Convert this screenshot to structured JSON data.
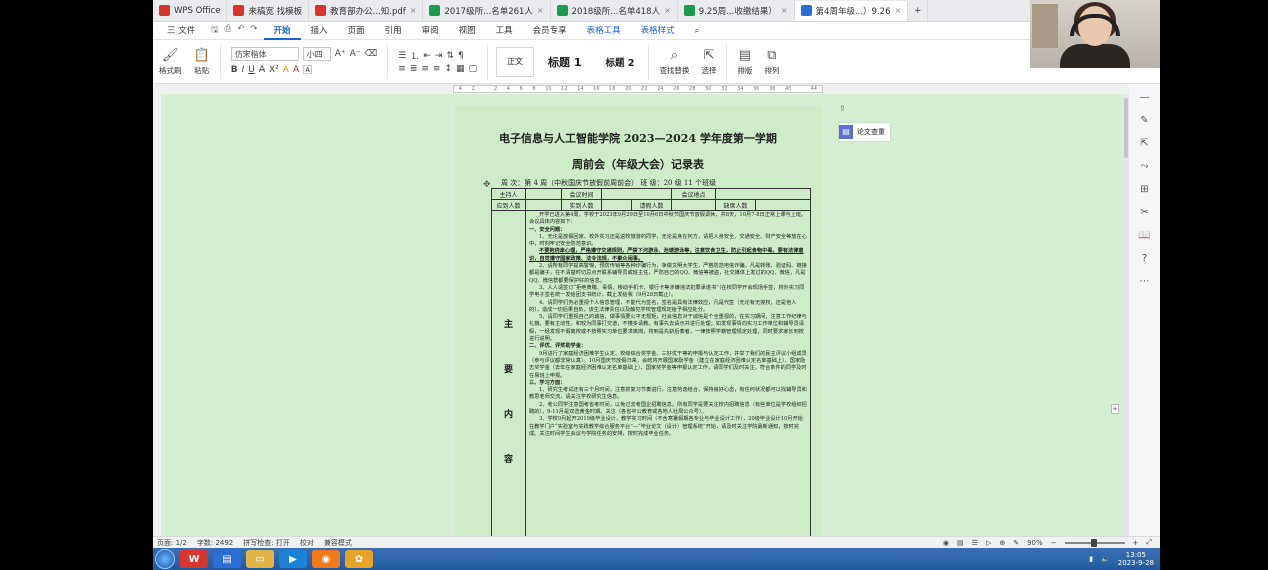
{
  "browser_tabs": [
    {
      "label": "WPS Office",
      "icon": "wps-logo-icon",
      "color": "#d9362b",
      "active": false
    },
    {
      "label": "来稿宽 找模板",
      "icon": "template-icon",
      "color": "#d9362b",
      "active": false
    },
    {
      "label": "教育部办公...知.pdf",
      "icon": "pdf-icon",
      "color": "#d9362b",
      "active": false
    },
    {
      "label": "2017级所...名单261人",
      "icon": "sheet-icon",
      "color": "#1c9a4f",
      "active": false
    },
    {
      "label": "2018级所...名单418人",
      "icon": "sheet-icon",
      "color": "#1c9a4f",
      "active": false
    },
    {
      "label": "9.25周...收缴结果）",
      "icon": "sheet-icon",
      "color": "#1c9a4f",
      "active": false
    },
    {
      "label": "第4周年级...）9.26",
      "icon": "doc-icon",
      "color": "#2b6fd6",
      "active": true
    }
  ],
  "menu": {
    "file": "三 文件",
    "items": [
      "开始",
      "插入",
      "页面",
      "引用",
      "审阅",
      "视图",
      "工具",
      "会员专享"
    ],
    "active": "开始",
    "extra": [
      "表格工具",
      "表格样式"
    ]
  },
  "ribbon": {
    "format_painter": "格式刷",
    "paste": "粘贴",
    "font_name": "仿宋楷体",
    "font_size": "小四",
    "style_normal": "正文",
    "style_h1": "标题 1",
    "style_h2": "标题 2",
    "find_replace": "查找替换",
    "select": "选择",
    "layout": "排版",
    "arrange": "排列"
  },
  "ruler_numbers": [
    "4",
    "2",
    "",
    "2",
    "4",
    "6",
    "8",
    "10",
    "12",
    "14",
    "16",
    "18",
    "20",
    "22",
    "24",
    "26",
    "28",
    "30",
    "32",
    "34",
    "36",
    "38",
    "40",
    "",
    "44"
  ],
  "document": {
    "title": "电子信息与人工智能学院 2023—2024 学年度第一学期",
    "subtitle": "周前会（年级大会）记录表",
    "week_line": "周 次：第 4 周（中秋国庆节放假前周前会）     班 级：20 级 11 个班级",
    "table_row1": [
      "主持人",
      "",
      "会议时间",
      "",
      "会议地点",
      ""
    ],
    "table_row2": [
      "应到人数",
      "",
      "实到人数",
      "",
      "请假人数",
      "",
      "缺席人数",
      ""
    ],
    "section_label": [
      "主",
      "要",
      "内",
      "容"
    ],
    "paragraphs": [
      "开学已进入第4周，学校于2023年9月29日至10月6日中秋节国庆节放假调休，共8天，10月7-8日正常上课与上班。会议具体内容如下：",
      "一、安全问题：",
      "1、无论是放假回家、校外实习还是返校旅游的同学，无论是身在何方，请把人身安全、交通安全、财产安全等放在心中，时刻牢记安全防范意识。",
      "不要抱侥幸心理，严格遵守交通规则，严禁下河游泳、池塘游泳等，注意饮食卫生，防止引起食物中毒。要有法律意识，自觉遵守国家政策、法令法规，不聚众闹事。",
      "2、请所有同学提高警惕，预防传销等各种诈骗行为，争做文明大学生，严格防范电信诈骗。凡是转账、验证码、链接都是骗子，在不清楚时切忌点开联系辅导员或班主任，严防自己的QQ、微信等被盗，社交媒体上发过的QQ、微信，凡是QQ、微信群都要保护好的信息。",
      "3、人人请签订“拒绝黄赌、毒情、移动手机卡、银行卡等涉嫌违法犯罪承诺书”（在校同学开会现场手签，校外实习同学电子签名统一发给团支书统计，截止发给我（9月28日截止）。",
      "4、请同学们务必重视个人信息管理，不能代为签名，签名是具有法律效应，凡是代签（无论有无授权，还是他人的），造成一切后果自负，该生法律责任以及触犯学校管理规定给予相应处分。",
      "5、请同学们重视自己的诚信，做事情要公平无规矩，社会信息对于诚信是个全重视的，在实习期间，注意工作纪律与礼貌，要有主动性，和较为同事打交道，不懂多请教。有事先去请示并进行处理；如发现事情向实习工作单位和辅导员请假，一经发现不假离校或不按照实习单位要求离岗，将到是先斩后奏者，一律按照学籍管理规定处理，同时要求家长到校进行说明。",
      "二、评优、评奖助学金：",
      "9月进行了家庭经济困难学生认定、校级综合奖学金、三好优干等的申报与认定工作，并举了我们的民主评议小组成员（参与评议都非常认真）。10月国庆节放假归来，会统将开展国家励学金（建立在家庭经济困难认定名单基础上）、国家励志奖学金（去年在家庭经济困难认定名单基础上）、国家奖学金等申报认定工作，请同学们及时关注，符合条件的同学及时在易班上申报。",
      "三、学习方面：",
      "1、研究生考试还有三个月时间，注意抓复习节奏进行，注意劳逸结合，保持良好心态，有任何状况都可以找辅导员和教思老师交流，请关注学校研究生信息。",
      "2、考公同学注意国考省考时间，以免过去考国企招聘信息。所有同学是要关注校内招聘信息（有些单位是学校组织招聘的），9-11月是双选黄金时期。关注（各省中公教育或各地人社局公众号）。",
      "3、学校9月起开2019级毕业设计，教学实习时间（不含寒暑假期各专业与毕业设计工作），20级毕业设计10月开始在教学门户“实验室与实践教学综合服务平台”—“毕业论文（设计）管理系统”开始，请及时关注学院最新通知，按时完成。关注时间学生会议与学院任务的安排，按时完成毕业任务。"
    ]
  },
  "side_float": {
    "paper_check": "论文查重"
  },
  "status": {
    "page": "页面: 1/2",
    "words": "字数: 2492",
    "spell": "拼写检查: 打开",
    "proof": "校对",
    "compat": "兼容模式",
    "zoom": "90%"
  },
  "taskbar": {
    "time": "13:05",
    "date": "2023-9-28"
  }
}
